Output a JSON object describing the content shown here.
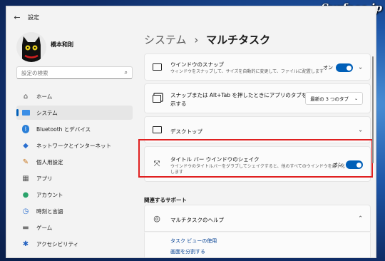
{
  "watermark": "Surface.jp",
  "window": {
    "title": "設定",
    "back_icon": "back-arrow-icon"
  },
  "user": {
    "name": "橋本和則"
  },
  "search": {
    "placeholder": "設定の検索"
  },
  "sidebar": {
    "items": [
      {
        "label": "ホーム",
        "icon": "home-icon",
        "active": false
      },
      {
        "label": "システム",
        "icon": "system-icon",
        "active": true
      },
      {
        "label": "Bluetooth とデバイス",
        "icon": "bluetooth-icon",
        "active": false
      },
      {
        "label": "ネットワークとインターネット",
        "icon": "wifi-icon",
        "active": false
      },
      {
        "label": "個人用設定",
        "icon": "brush-icon",
        "active": false
      },
      {
        "label": "アプリ",
        "icon": "apps-icon",
        "active": false
      },
      {
        "label": "アカウント",
        "icon": "account-icon",
        "active": false
      },
      {
        "label": "時刻と言語",
        "icon": "clock-icon",
        "active": false
      },
      {
        "label": "ゲーム",
        "icon": "game-icon",
        "active": false
      },
      {
        "label": "アクセシビリティ",
        "icon": "accessibility-icon",
        "active": false
      }
    ]
  },
  "page": {
    "breadcrumb_parent": "システム",
    "separator": "›",
    "title": "マルチタスク"
  },
  "settings": {
    "snap": {
      "title": "ウインドウのスナップ",
      "desc": "ウィンドウをスナップして、サイズを自動的に変更して、ファイルに配置します",
      "state": "オン"
    },
    "alttab": {
      "title_line1": "スナップまたは Alt+Tab を押したときにアプリのタブを表",
      "title_line2": "示する",
      "value": "最新の 3 つのタブ"
    },
    "desktop": {
      "title": "デスクトップ"
    },
    "shake": {
      "title": "タイトル バー ウインドウのシェイク",
      "desc_line1": "ウインドウのタイトルバーをグラブしてシェイクすると、他のすべてのウインドウを最小化",
      "desc_line2": "します",
      "state": "オン"
    }
  },
  "related": {
    "heading": "関連するサポート",
    "help_title": "マルチタスクのヘルプ",
    "links": [
      "タスク ビューの使用",
      "画面を分割する"
    ]
  },
  "colors": {
    "accent": "#005fb8",
    "highlight": "#e02020"
  }
}
